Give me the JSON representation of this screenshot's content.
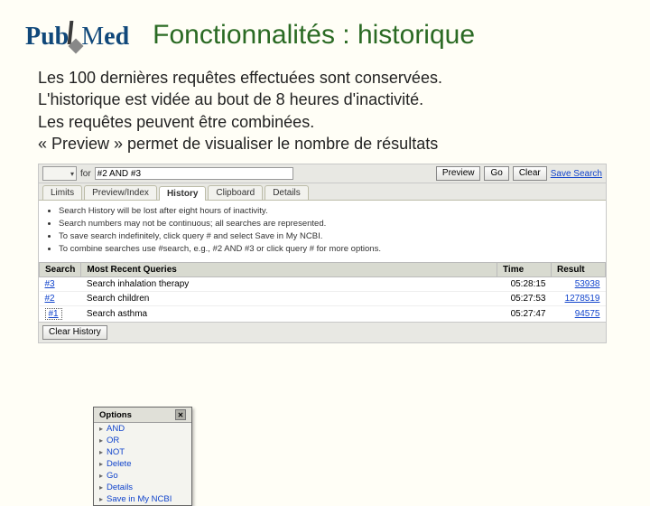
{
  "header": {
    "logo_part1": "Pub",
    "logo_part2": "ed",
    "title": "Fonctionnalités : historique"
  },
  "description": {
    "l1": "Les 100 dernières requêtes effectuées sont conservées.",
    "l2": "L'historique est vidée au bout de 8 heures d'inactivité.",
    "l3": "Les requêtes peuvent être combinées.",
    "l4": "« Preview » permet de visualiser le nombre de résultats"
  },
  "searchbar": {
    "db_selected": "",
    "for_label": "for",
    "input_value": "#2 AND #3",
    "btn_preview": "Preview",
    "btn_go": "Go",
    "btn_clear": "Clear",
    "save_search": "Save Search"
  },
  "tabs": {
    "limits": "Limits",
    "preview": "Preview/Index",
    "history": "History",
    "clipboard": "Clipboard",
    "details": "Details"
  },
  "bullets": {
    "b1": "Search History will be lost after eight hours of inactivity.",
    "b2": "Search numbers may not be continuous; all searches are represented.",
    "b3": "To save search indefinitely, click query # and select Save in My NCBI.",
    "b4": "To combine searches use #search, e.g., #2 AND #3 or click query # for more options."
  },
  "table": {
    "h_search": "Search",
    "h_queries": "Most Recent Queries",
    "h_time": "Time",
    "h_result": "Result",
    "rows": [
      {
        "id": "#3",
        "query": "Search inhalation therapy",
        "time": "05:28:15",
        "result": "53938"
      },
      {
        "id": "#2",
        "query": "Search children",
        "time": "05:27:53",
        "result": "1278519"
      },
      {
        "id": "#1",
        "query": "Search asthma",
        "time": "05:27:47",
        "result": "94575"
      }
    ]
  },
  "bottombar": {
    "btn_clear_history": "Clear History"
  },
  "menu": {
    "title": "Options",
    "items": [
      "AND",
      "OR",
      "NOT",
      "Delete",
      "Go",
      "Details",
      "Save in My NCBI"
    ]
  }
}
